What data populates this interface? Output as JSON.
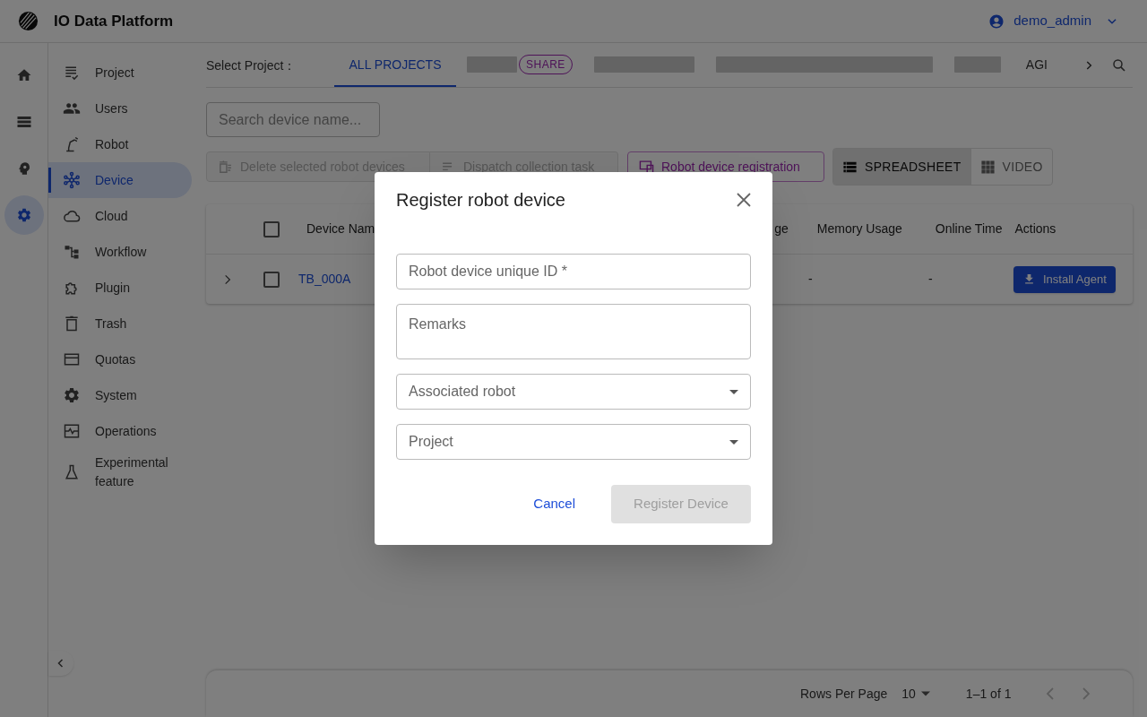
{
  "app": {
    "title": "IO Data Platform"
  },
  "user": {
    "name": "demo_admin"
  },
  "rail": [
    {
      "kind": "home",
      "selected": false
    },
    {
      "kind": "storage",
      "selected": false
    },
    {
      "kind": "insight",
      "selected": false
    },
    {
      "kind": "settings",
      "selected": true
    }
  ],
  "sidebar": {
    "items": [
      {
        "label": "Project",
        "kind": "project",
        "selected": false
      },
      {
        "label": "Users",
        "kind": "users",
        "selected": false
      },
      {
        "label": "Robot",
        "kind": "robot",
        "selected": false
      },
      {
        "label": "Device",
        "kind": "device",
        "selected": true
      },
      {
        "label": "Cloud",
        "kind": "cloud",
        "selected": false
      },
      {
        "label": "Workflow",
        "kind": "workflow",
        "selected": false
      },
      {
        "label": "Plugin",
        "kind": "plugin",
        "selected": false
      },
      {
        "label": "Trash",
        "kind": "trash",
        "selected": false
      },
      {
        "label": "Quotas",
        "kind": "quotas",
        "selected": false
      },
      {
        "label": "System",
        "kind": "system",
        "selected": false
      },
      {
        "label": "Operations",
        "kind": "operations",
        "selected": false
      },
      {
        "label": "Experimental feature",
        "kind": "experimental",
        "selected": false
      }
    ]
  },
  "project_tabs": {
    "label": "Select Project：",
    "tabs": [
      {
        "kind": "text",
        "label": "ALL PROJECTS",
        "selected": true
      },
      {
        "kind": "redacted",
        "badge": "SHARE",
        "selected": false
      },
      {
        "kind": "redacted",
        "selected": false
      },
      {
        "kind": "redacted",
        "selected": false
      },
      {
        "kind": "redacted",
        "selected": false
      },
      {
        "kind": "text",
        "label": "AGI",
        "selected": false
      }
    ]
  },
  "search": {
    "placeholder": "Search device name..."
  },
  "toolbar": {
    "actions": [
      {
        "label": "Delete selected robot devices",
        "kind": "delete",
        "disabled": true
      },
      {
        "label": "Dispatch collection task",
        "kind": "dispatch",
        "disabled": true
      },
      {
        "label": "Robot device registration",
        "kind": "register",
        "disabled": false
      }
    ],
    "views": [
      {
        "label": "SPREADSHEET",
        "kind": "list",
        "selected": true
      },
      {
        "label": "VIDEO",
        "kind": "grid",
        "selected": false
      }
    ]
  },
  "table": {
    "header_checked": false,
    "columns": [
      "Device Nam",
      "ge",
      "Memory Usage",
      "Online Time",
      "Actions"
    ],
    "rows": [
      {
        "expanded": false,
        "checked": false,
        "device_name": "TB_000A",
        "memory_usage": "-",
        "online_time": "-",
        "action": "Install Agent"
      }
    ]
  },
  "pagination": {
    "rows_per_page_label": "Rows Per Page",
    "rows_per_page": "10",
    "range": "1–1 of 1"
  },
  "dialog": {
    "title": "Register robot device",
    "fields": [
      {
        "kind": "text",
        "label": "Robot device unique ID *"
      },
      {
        "kind": "textarea",
        "label": "Remarks"
      },
      {
        "kind": "select",
        "label": "Associated robot"
      },
      {
        "kind": "select",
        "label": "Project"
      }
    ],
    "cancel": "Cancel",
    "submit": {
      "label": "Register Device",
      "disabled": true
    }
  }
}
